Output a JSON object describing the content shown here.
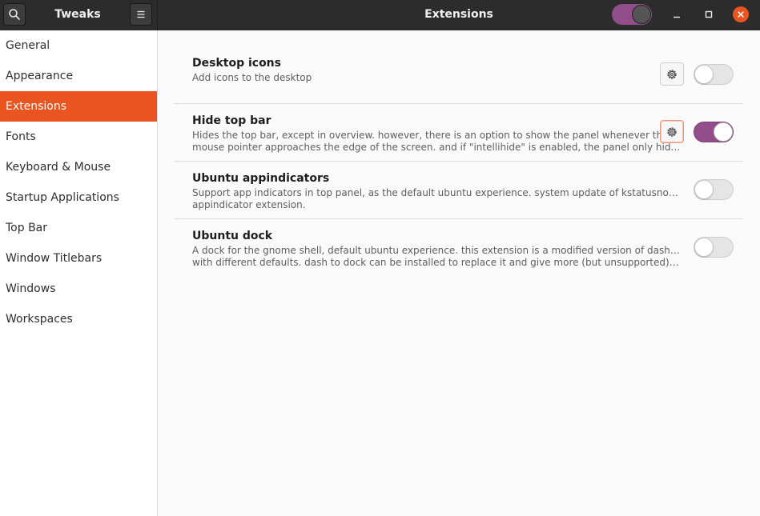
{
  "header": {
    "app_title": "Tweaks",
    "page_title": "Extensions",
    "search_icon": "search-icon",
    "menu_icon": "hamburger-menu-icon",
    "dark_mode_switch": "on",
    "colors": {
      "bar": "#2c2c2c",
      "accent": "#e95420",
      "purple": "#924d8b"
    }
  },
  "sidebar": {
    "items": [
      {
        "label": "General"
      },
      {
        "label": "Appearance"
      },
      {
        "label": "Extensions",
        "active": true
      },
      {
        "label": "Fonts"
      },
      {
        "label": "Keyboard & Mouse"
      },
      {
        "label": "Startup Applications"
      },
      {
        "label": "Top Bar"
      },
      {
        "label": "Window Titlebars"
      },
      {
        "label": "Windows"
      },
      {
        "label": "Workspaces"
      }
    ]
  },
  "extensions": [
    {
      "name": "Desktop icons",
      "desc1": "Add icons to the desktop",
      "desc2": "",
      "has_settings": true,
      "enabled": false
    },
    {
      "name": "Hide top bar",
      "desc1": "Hides the top bar, except in overview. however, there is an option to show the panel whenever the",
      "desc2": "mouse pointer approaches the edge of the screen. and if \"intellihide\" is enabled, the panel only hid…",
      "has_settings": true,
      "enabled": true
    },
    {
      "name": "Ubuntu appindicators",
      "desc1": "Support app indicators in top panel, as the default ubuntu experience. system update of kstatusnotifieritem/-",
      "desc2": "appindicator extension.",
      "has_settings": false,
      "enabled": false
    },
    {
      "name": "Ubuntu dock",
      "desc1": "A dock for the gnome shell, default ubuntu experience. this extension is a modified version of dash to dock",
      "desc2": "with different defaults. dash to dock can be installed to replace it and give more (but unsupported) configu…",
      "has_settings": false,
      "enabled": false
    }
  ]
}
